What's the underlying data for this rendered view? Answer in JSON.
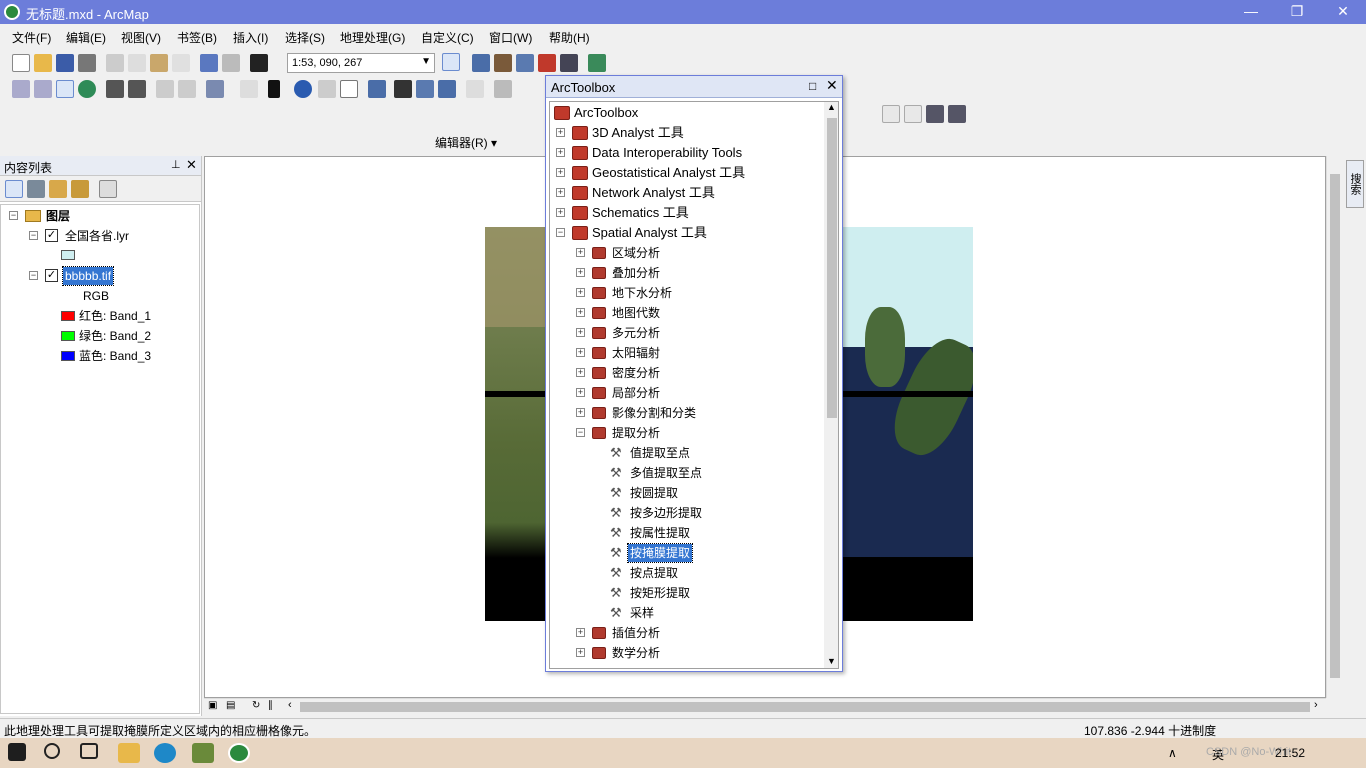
{
  "window": {
    "title": "无标题.mxd - ArcMap",
    "min": "—",
    "restore": "❐",
    "close": "✕"
  },
  "menu": [
    "文件(F)",
    "编辑(E)",
    "视图(V)",
    "书签(B)",
    "插入(I)",
    "选择(S)",
    "地理处理(G)",
    "自定义(C)",
    "窗口(W)",
    "帮助(H)"
  ],
  "toolbar": {
    "scale": "1:53, 090, 267",
    "editor_label": "编辑器(R) ▾"
  },
  "toc": {
    "title": "内容列表",
    "pin": "⊥",
    "close": "✕",
    "root_label": "图层",
    "layer1": "全国各省.lyr",
    "layer2": "bbbbb.tif",
    "rgb_label": "RGB",
    "bands": [
      {
        "label": "红色:    Band_1",
        "color": "#ff0000"
      },
      {
        "label": "绿色: Band_2",
        "color": "#00ff00"
      },
      {
        "label": "蓝色:    Band_3",
        "color": "#0000ff"
      }
    ]
  },
  "arctoolbox": {
    "title": "ArcToolbox",
    "root": "ArcToolbox",
    "toolboxes": [
      "3D Analyst 工具",
      "Data Interoperability Tools",
      "Geostatistical Analyst 工具",
      "Network Analyst 工具",
      "Schematics 工具",
      "Spatial Analyst 工具"
    ],
    "spatial_sets": [
      "区域分析",
      "叠加分析",
      "地下水分析",
      "地图代数",
      "多元分析",
      "太阳辐射",
      "密度分析",
      "局部分析",
      "影像分割和分类",
      "提取分析"
    ],
    "extract_tools": [
      "值提取至点",
      "多值提取至点",
      "按圆提取",
      "按多边形提取",
      "按属性提取",
      "按掩膜提取",
      "按点提取",
      "按矩形提取",
      "采样"
    ],
    "after_sets": [
      "插值分析",
      "数学分析"
    ],
    "selected_tool": "按掩膜提取"
  },
  "side_tab": "搜索",
  "status": {
    "message": "此地理处理工具可提取掩膜所定义区域内的相应栅格像元。",
    "coords": "107.836  -2.944 十进制度"
  },
  "taskbar": {
    "tray_lang": "英",
    "watermark": "CSDN @No-Whit-_",
    "time": "21:52"
  },
  "colors": {
    "titlebar": "#6c7dda",
    "selection": "#3476d2"
  }
}
